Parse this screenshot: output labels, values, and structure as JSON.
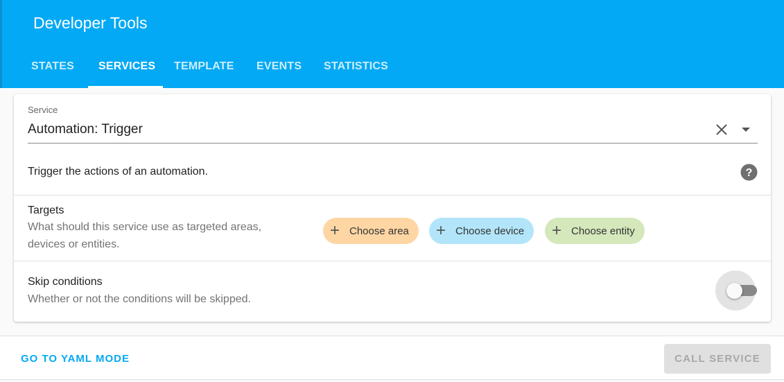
{
  "header": {
    "title": "Developer Tools",
    "tabs": [
      {
        "label": "STATES"
      },
      {
        "label": "SERVICES",
        "active": true
      },
      {
        "label": "TEMPLATE"
      },
      {
        "label": "EVENTS"
      },
      {
        "label": "STATISTICS"
      }
    ]
  },
  "service": {
    "label": "Service",
    "value": "Automation: Trigger",
    "description": "Trigger the actions of an automation."
  },
  "targets": {
    "title": "Targets",
    "description_line1": "What should this service use as targeted areas,",
    "description_line2": "devices or entities.",
    "chips": [
      {
        "label": "Choose area",
        "color": "#fed6a4"
      },
      {
        "label": "Choose device",
        "color": "#b2e5f9"
      },
      {
        "label": "Choose entity",
        "color": "#d4e8bb"
      }
    ]
  },
  "skip": {
    "title": "Skip conditions",
    "description": "Whether or not the conditions will be skipped.",
    "enabled": false
  },
  "footer": {
    "yaml_label": "GO TO YAML MODE",
    "call_label": "CALL SERVICE"
  },
  "colors": {
    "primary": "#03a9f4"
  }
}
